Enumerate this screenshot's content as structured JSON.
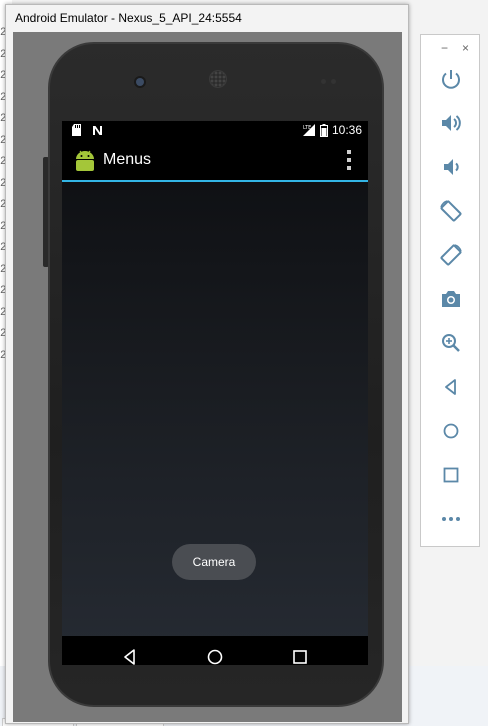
{
  "emulator": {
    "title": "Android Emulator - Nexus_5_API_24:5554"
  },
  "background": {
    "line_digits": [
      "2",
      "2",
      "2",
      "2",
      "2",
      "2",
      "2",
      "2",
      "2",
      "2",
      "2",
      "2",
      "2",
      "2",
      "2",
      "2"
    ]
  },
  "status_bar": {
    "time": "10:36",
    "left_icons": [
      "sd-card-icon",
      "n-notification-icon"
    ],
    "right_icons": [
      "lte-signal-icon",
      "battery-icon"
    ]
  },
  "app_bar": {
    "title": "Menus",
    "icon": "android-robot-icon",
    "overflow_icon": "overflow-menu-icon"
  },
  "toast": {
    "text": "Camera"
  },
  "nav_bar": {
    "buttons": [
      "back-icon",
      "home-icon",
      "recents-icon"
    ]
  },
  "toolbar": {
    "minimize_label": "−",
    "close_label": "×",
    "buttons": [
      "power-icon",
      "volume-up-icon",
      "volume-down-icon",
      "rotate-left-icon",
      "rotate-right-icon",
      "screenshot-icon",
      "zoom-icon",
      "back-icon",
      "home-icon",
      "overview-icon",
      "more-icon"
    ]
  },
  "colors": {
    "accent": "#33b5e5",
    "android_green": "#a4c639",
    "toolbar_icon": "#5b88a8"
  }
}
